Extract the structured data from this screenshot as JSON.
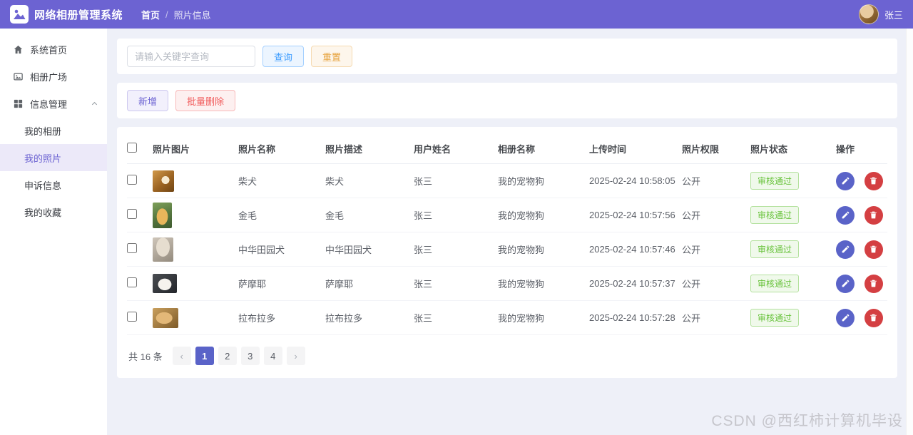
{
  "app": {
    "title": "网络相册管理系统",
    "user_name": "张三"
  },
  "breadcrumb": {
    "home": "首页",
    "sep": "/",
    "current": "照片信息"
  },
  "sidebar": {
    "items": [
      {
        "label": "系统首页"
      },
      {
        "label": "相册广场"
      },
      {
        "label": "信息管理"
      },
      {
        "label": "我的相册"
      },
      {
        "label": "我的照片"
      },
      {
        "label": "申诉信息"
      },
      {
        "label": "我的收藏"
      }
    ]
  },
  "toolbar": {
    "search_placeholder": "请输入关键字查询",
    "query_label": "查询",
    "reset_label": "重置",
    "add_label": "新增",
    "batch_delete_label": "批量删除"
  },
  "table": {
    "headers": [
      "照片图片",
      "照片名称",
      "照片描述",
      "用户姓名",
      "相册名称",
      "上传时间",
      "照片权限",
      "照片状态",
      "操作"
    ],
    "rows": [
      {
        "name": "柴犬",
        "desc": "柴犬",
        "user": "张三",
        "album": "我的宠物狗",
        "time": "2025-02-24 10:58:05",
        "perm": "公开",
        "status": "审核通过"
      },
      {
        "name": "金毛",
        "desc": "金毛",
        "user": "张三",
        "album": "我的宠物狗",
        "time": "2025-02-24 10:57:56",
        "perm": "公开",
        "status": "审核通过"
      },
      {
        "name": "中华田园犬",
        "desc": "中华田园犬",
        "user": "张三",
        "album": "我的宠物狗",
        "time": "2025-02-24 10:57:46",
        "perm": "公开",
        "status": "审核通过"
      },
      {
        "name": "萨摩耶",
        "desc": "萨摩耶",
        "user": "张三",
        "album": "我的宠物狗",
        "time": "2025-02-24 10:57:37",
        "perm": "公开",
        "status": "审核通过"
      },
      {
        "name": "拉布拉多",
        "desc": "拉布拉多",
        "user": "张三",
        "album": "我的宠物狗",
        "time": "2025-02-24 10:57:28",
        "perm": "公开",
        "status": "审核通过"
      }
    ]
  },
  "pagination": {
    "total_text": "共 16 条",
    "prev": "‹",
    "next": "›",
    "pages": [
      "1",
      "2",
      "3",
      "4"
    ],
    "active_page": "1"
  },
  "watermark": "CSDN @西红柿计算机毕设",
  "colors": {
    "theme_purple": "#6c63d2",
    "edit_button": "#5a63c8",
    "delete_button": "#d43f42",
    "status_success_text": "#67c23a"
  }
}
